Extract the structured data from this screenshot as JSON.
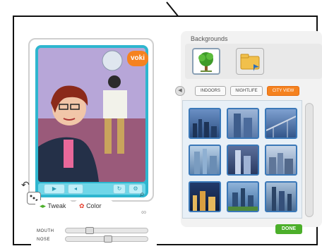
{
  "backgrounds": {
    "title": "Backgrounds",
    "filters": [
      {
        "label": "INDOORS"
      },
      {
        "label": "NIGHTLIFE"
      },
      {
        "label": "CITY VIEW"
      }
    ],
    "active_filter": "CITY VIEW"
  },
  "character": {
    "badge": "voki"
  },
  "tweak_panel": {
    "tabs": [
      {
        "label": "Tweak"
      },
      {
        "label": "Color"
      }
    ],
    "sliders": [
      {
        "label": "MOUTH",
        "value": 0.22
      },
      {
        "label": "NOSE",
        "value": 0.5
      }
    ]
  },
  "done_button": "DONE",
  "colors": {
    "accent": "#f5821f",
    "panel_teal": "#2eb6cf",
    "done_green": "#4caf2a",
    "thumb_border": "#3a78b8"
  }
}
